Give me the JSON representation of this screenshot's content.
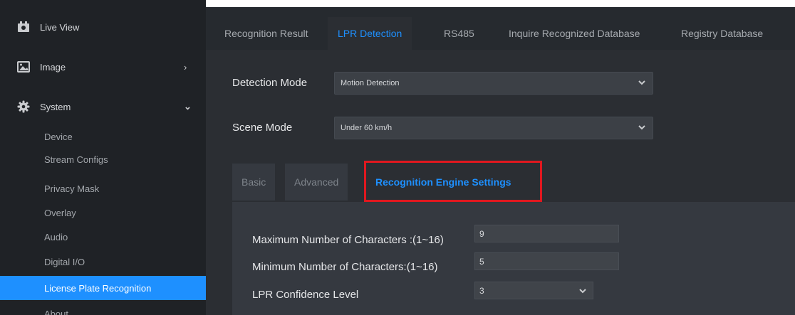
{
  "sidebar": {
    "top_items": [
      {
        "label": "Live View",
        "icon": "video-camera-icon"
      },
      {
        "label": "Image",
        "icon": "image-icon",
        "chevron": "›"
      },
      {
        "label": "System",
        "icon": "gear-icon",
        "chevron": "⌄"
      }
    ],
    "sub_items": [
      {
        "label": "Device"
      },
      {
        "label": "Stream Configs"
      },
      {
        "label": "Privacy Mask"
      },
      {
        "label": "Overlay"
      },
      {
        "label": "Audio"
      },
      {
        "label": "Digital I/O"
      },
      {
        "label": "License Plate Recognition",
        "active": true
      },
      {
        "label": "About"
      }
    ]
  },
  "tabs": [
    {
      "label": "Recognition Result"
    },
    {
      "label": "LPR Detection",
      "active": true
    },
    {
      "label": "RS485"
    },
    {
      "label": "Inquire Recognized Database"
    },
    {
      "label": "Registry Database"
    }
  ],
  "detection_mode": {
    "label": "Detection Mode",
    "value": "Motion Detection"
  },
  "scene_mode": {
    "label": "Scene Mode",
    "value": "Under 60 km/h"
  },
  "subtabs": [
    {
      "label": "Basic"
    },
    {
      "label": "Advanced"
    },
    {
      "label": "Recognition Engine Settings",
      "active": true
    }
  ],
  "settings": {
    "max_chars": {
      "label": "Maximum Number of Characters :(1~16)",
      "value": "9"
    },
    "min_chars": {
      "label": "Minimum Number of Characters:(1~16)",
      "value": "5"
    },
    "confidence": {
      "label": "LPR Confidence Level",
      "value": "3"
    }
  },
  "colors": {
    "accent": "#1e90ff",
    "highlight": "#e0181f"
  }
}
